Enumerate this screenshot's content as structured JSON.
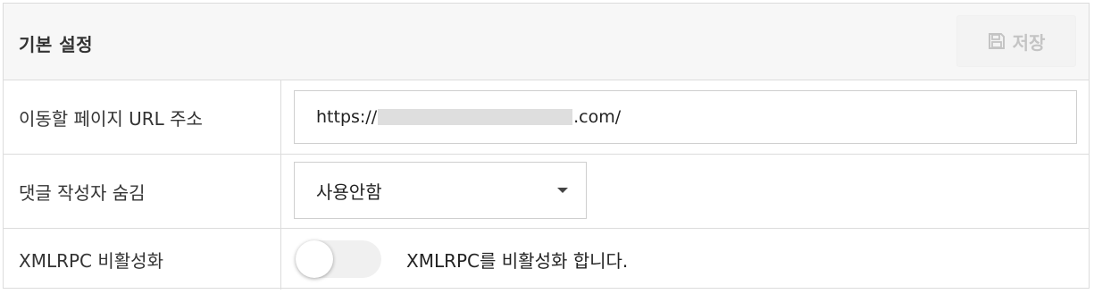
{
  "header": {
    "title": "기본 설정",
    "save_label": "저장"
  },
  "rows": [
    {
      "label": "이동할 페이지 URL 주소",
      "value_prefix": "https://",
      "value_suffix": ".com/"
    },
    {
      "label": "댓글 작성자 숨김",
      "selected_option": "사용안함"
    },
    {
      "label": "XMLRPC 비활성화",
      "toggle_on": false,
      "description": "XMLRPC를 비활성화 합니다."
    }
  ],
  "colors": {
    "header_bg": "#f7f7f7",
    "border": "#dcdcdc",
    "save_disabled_text": "#c4c4c4",
    "toggle_track": "#f0f0f0"
  },
  "icons": {
    "save": "floppy-disk-icon",
    "dropdown": "caret-down-icon"
  }
}
